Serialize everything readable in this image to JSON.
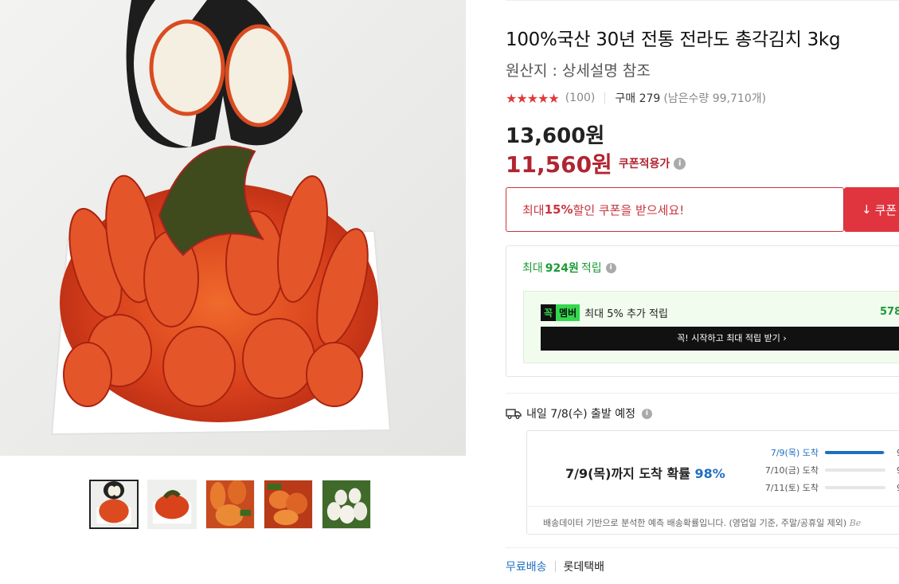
{
  "product": {
    "title": "100%국산 30년 전통 전라도 총각김치 3kg",
    "origin": "원산지 : 상세설명 참조",
    "stars": "★★★★★",
    "review_count": "(100)",
    "purchase": "구매 279",
    "remaining": "(남은수량 99,710개)",
    "original_price": "13,600원",
    "sale_price": "11,560원",
    "coupon_available": "쿠폰적용가"
  },
  "coupon": {
    "text_prefix": "최대 ",
    "text_pct": "15%",
    "text_suffix": " 할인 쿠폰을 받으세요!",
    "button": "쿠폰"
  },
  "points": {
    "prefix": "최대",
    "amount": "924원",
    "suffix": "적립",
    "badge_kkok": "꼭",
    "badge_member": "멤버",
    "member_text": "최대 5% 추가 적립",
    "member_amount": "578",
    "cta": "꼭! 시작하고 최대 적립 받기 ›"
  },
  "shipping": {
    "eta": "내일 7/8(수) 출발 예정",
    "headline_prefix": "7/9(목)까지 도착 확률",
    "headline_pct": "98%",
    "rows": [
      {
        "label": "7/9(목) 도착",
        "value": "9",
        "fill": 0.98
      },
      {
        "label": "7/10(금) 도착",
        "value": "9",
        "fill": 0.0
      },
      {
        "label": "7/11(토) 도착",
        "value": "9",
        "fill": 0.0
      }
    ],
    "note": "배송데이터 기반으로 분석한 예측 배송확률입니다. (영업일 기준, 주말/공휴일 제외)",
    "note_brand": "Be",
    "free": "무료배송",
    "courier": "롯데택배"
  },
  "colors": {
    "accent_red": "#b02531",
    "green": "#1d9b36",
    "blue": "#1f6fc0"
  }
}
